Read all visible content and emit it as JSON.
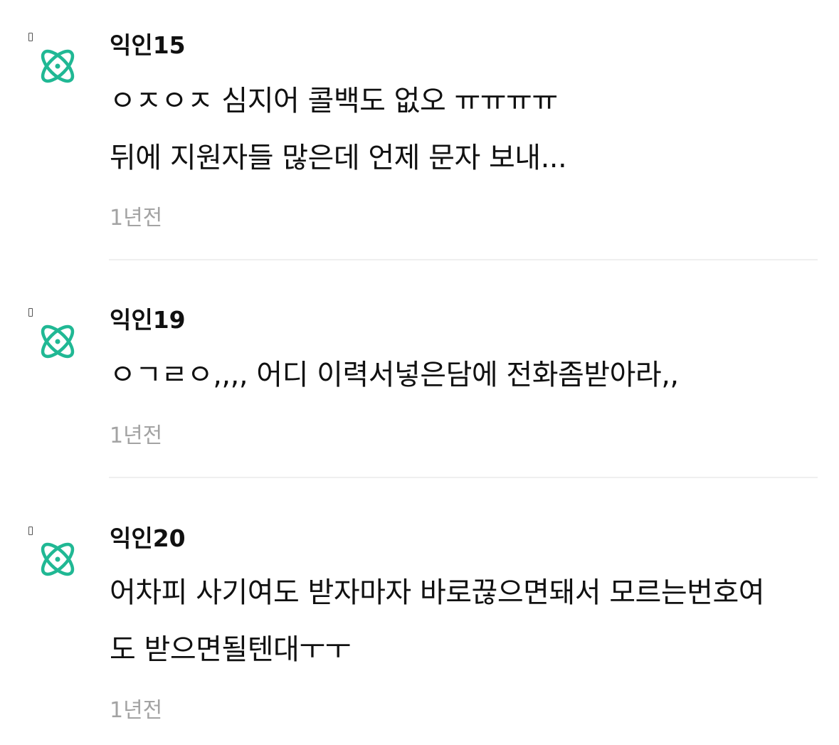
{
  "theme": {
    "avatar_color": "#20b894",
    "text_color": "#111111",
    "time_color": "#a3a3a3",
    "divider_color": "#efefef"
  },
  "comments": [
    {
      "avatar_icon": "atom-icon",
      "author": "익인15",
      "lines": [
        "ㅇㅈㅇㅈ 심지어 콜백도 없오 ㅠㅠㅠㅠ",
        "뒤에 지원자들 많은데 언제 문자 보내..."
      ],
      "time": "1년전"
    },
    {
      "avatar_icon": "atom-icon",
      "author": "익인19",
      "lines": [
        "ㅇㄱㄹㅇ,,,, 어디 이력서넣은담에 전화좀받아라,,"
      ],
      "time": "1년전"
    },
    {
      "avatar_icon": "atom-icon",
      "author": "익인20",
      "lines": [
        "어차피 사기여도 받자마자 바로끊으면돼서 모르는번호여",
        "도 받으면될텐대ㅜㅜ"
      ],
      "time": "1년전"
    }
  ]
}
